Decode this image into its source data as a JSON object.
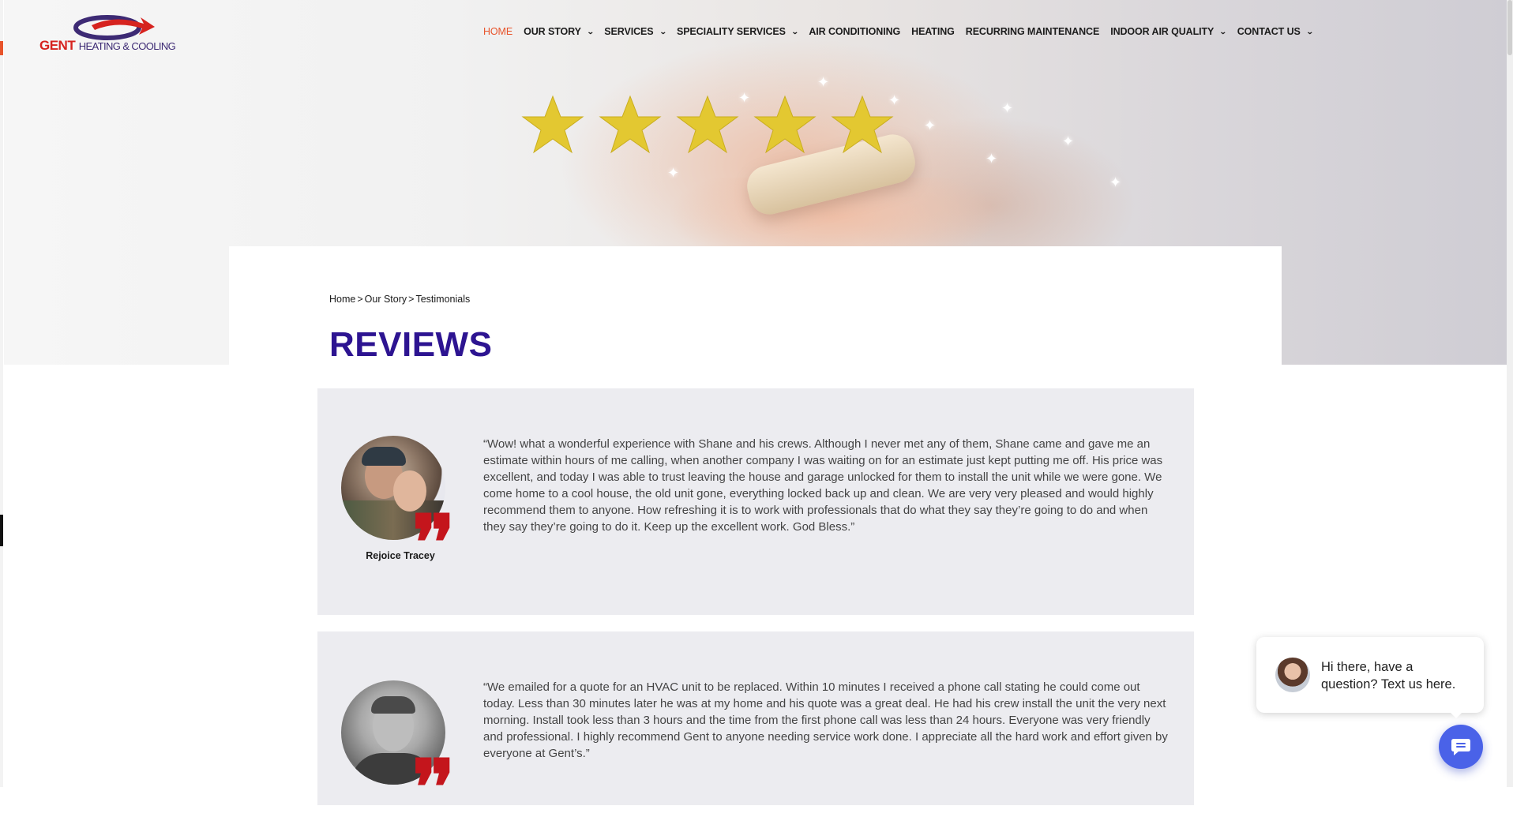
{
  "brand": {
    "name_primary": "GENT",
    "name_secondary": "HEATING & COOLING"
  },
  "nav": [
    {
      "label": "HOME",
      "active": true,
      "dropdown": false
    },
    {
      "label": "OUR STORY",
      "active": false,
      "dropdown": true
    },
    {
      "label": "SERVICES",
      "active": false,
      "dropdown": true
    },
    {
      "label": "SPECIALITY SERVICES",
      "active": false,
      "dropdown": true
    },
    {
      "label": "AIR CONDITIONING",
      "active": false,
      "dropdown": false
    },
    {
      "label": "HEATING",
      "active": false,
      "dropdown": false
    },
    {
      "label": "RECURRING MAINTENANCE",
      "active": false,
      "dropdown": false
    },
    {
      "label": "INDOOR AIR QUALITY",
      "active": false,
      "dropdown": true
    },
    {
      "label": "CONTACT US",
      "active": false,
      "dropdown": true
    }
  ],
  "hero": {
    "star_count": 5,
    "star_color": "#e3c831"
  },
  "breadcrumb": {
    "items": [
      "Home",
      "Our Story",
      "Testimonials"
    ],
    "separator": ">"
  },
  "page": {
    "title": "REVIEWS"
  },
  "reviews": [
    {
      "name": "Rejoice Tracey",
      "text": "“Wow! what a wonderful experience with Shane and his crews. Although I never met any of them, Shane came and gave me an estimate within hours of me calling, when another company I was waiting on for an estimate just kept putting me off. His price was excellent, and today I was able to trust leaving the house and garage unlocked for them to install the unit while we were gone. We come home to a cool house, the old unit gone, everything locked back up and clean. We are very very pleased and would highly recommend them to anyone. How refreshing it is to work with professionals that do what they say they’re going to do and when they say they’re going to do it. Keep up the excellent work. God Bless.”"
    },
    {
      "name": "",
      "text": "“We emailed for a quote for an HVAC unit to be replaced. Within 10 minutes I received a phone call stating he could come out today. Less than 30 minutes later he was at my home and his quote was a great deal. He had his crew install the unit the very next morning. Install took less than 3 hours and the time from the first phone call was less than 24 hours. Everyone was very friendly and professional. I highly recommend Gent to anyone needing service work done. I appreciate all the hard work and effort given by everyone at Gent’s.”"
    }
  ],
  "chat": {
    "message": "Hi there, have a question? Text us here.",
    "button_icon": "chat-icon"
  },
  "colors": {
    "accent": "#e8542b",
    "title": "#2d1491",
    "quote": "#c4151c",
    "review_bg": "#ececf0",
    "chat_button": "#4a62e8"
  }
}
